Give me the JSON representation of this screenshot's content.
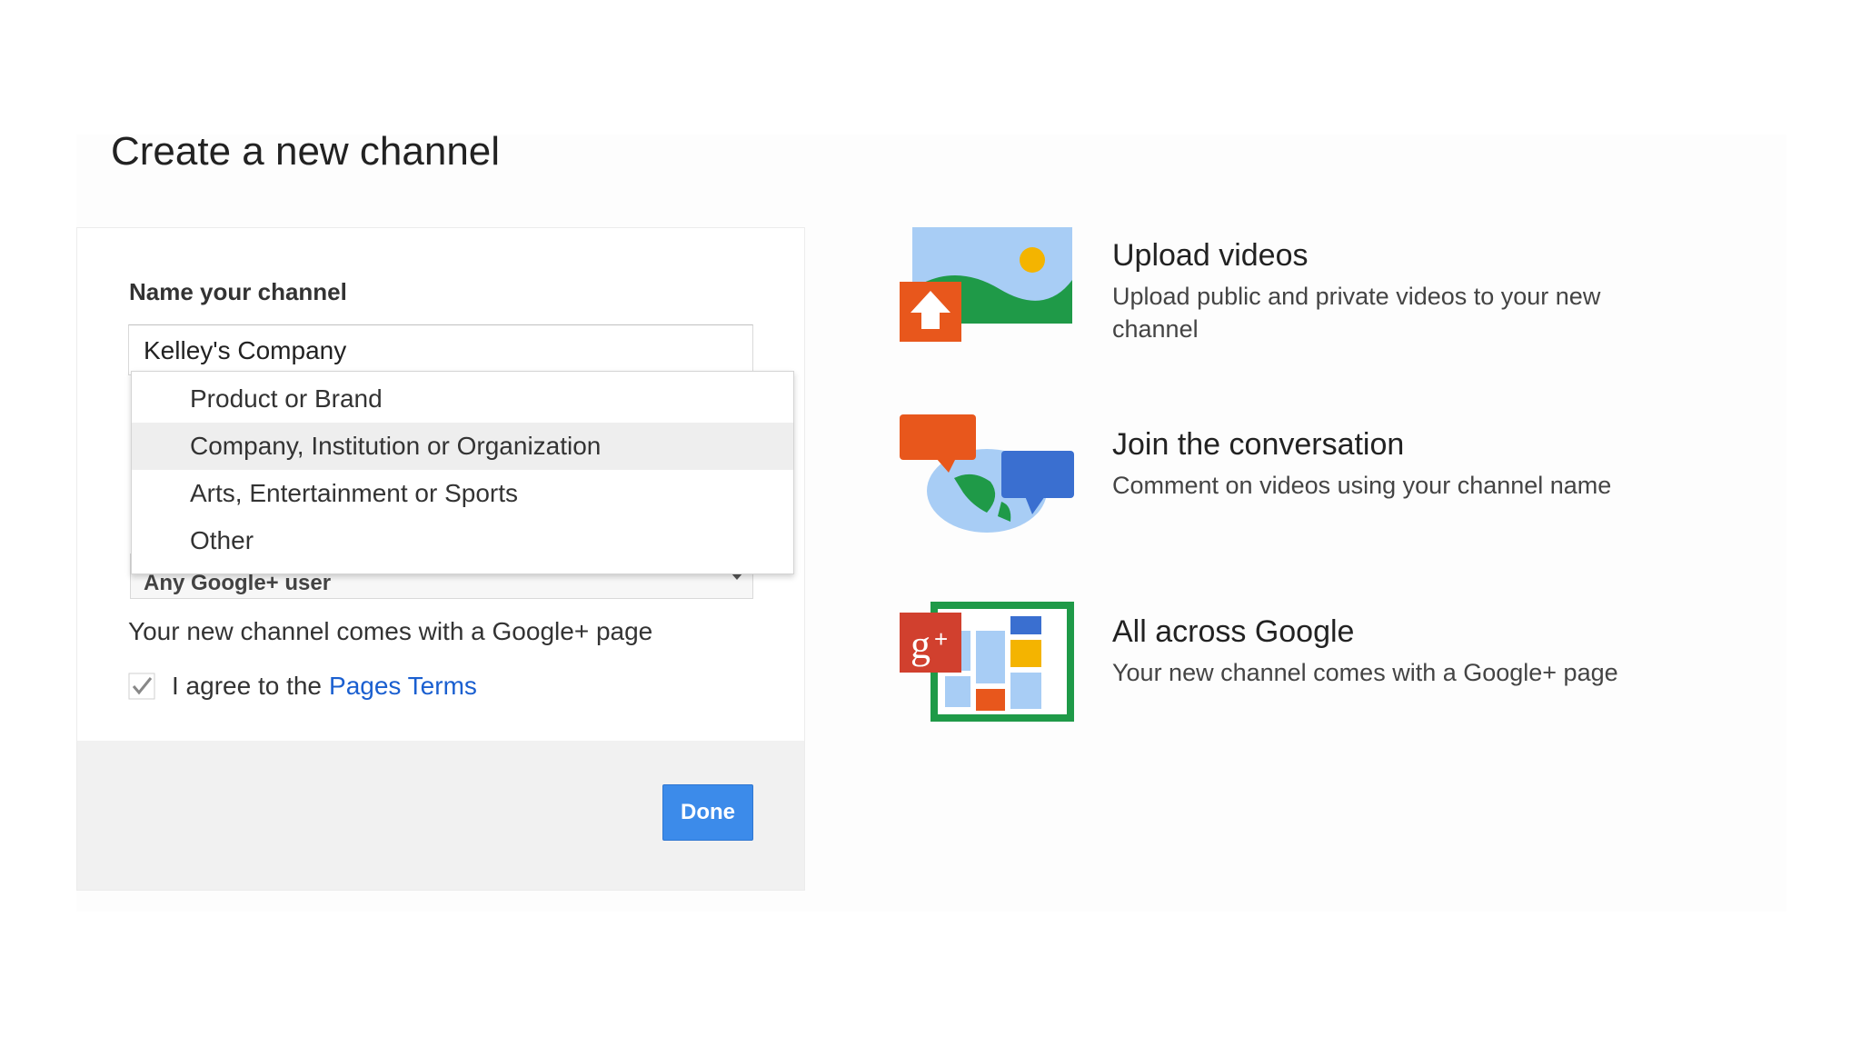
{
  "page": {
    "title": "Create a new channel"
  },
  "form": {
    "section_label": "Name your channel",
    "channel_name_value": "Kelley's Company",
    "category_options": [
      "Product or Brand",
      "Company, Institution or Organization",
      "Arts, Entertainment or Sports",
      "Other"
    ],
    "selected_category": "Company, Institution or Organization",
    "audience_select_value": "Any Google+ user",
    "google_plus_note": "Your new channel comes with a Google+ page",
    "agree_text": "I agree to the",
    "terms_link": "Pages Terms",
    "terms_checked": true,
    "done_label": "Done"
  },
  "features": [
    {
      "icon": "upload-videos-icon",
      "title": "Upload videos",
      "description": "Upload public and private videos to your new channel"
    },
    {
      "icon": "conversation-icon",
      "title": "Join the conversation",
      "description": "Comment on videos using your channel name"
    },
    {
      "icon": "google-plus-page-icon",
      "title": "All across Google",
      "description": "Your new channel comes with a Google+ page"
    }
  ],
  "colors": {
    "done_button": "#3c8bea",
    "link": "#1a5fd0",
    "upload_orange": "#e8571c",
    "green": "#1f9a48",
    "sky": "#a8cdf5",
    "google_plus_red": "#d1402e"
  }
}
